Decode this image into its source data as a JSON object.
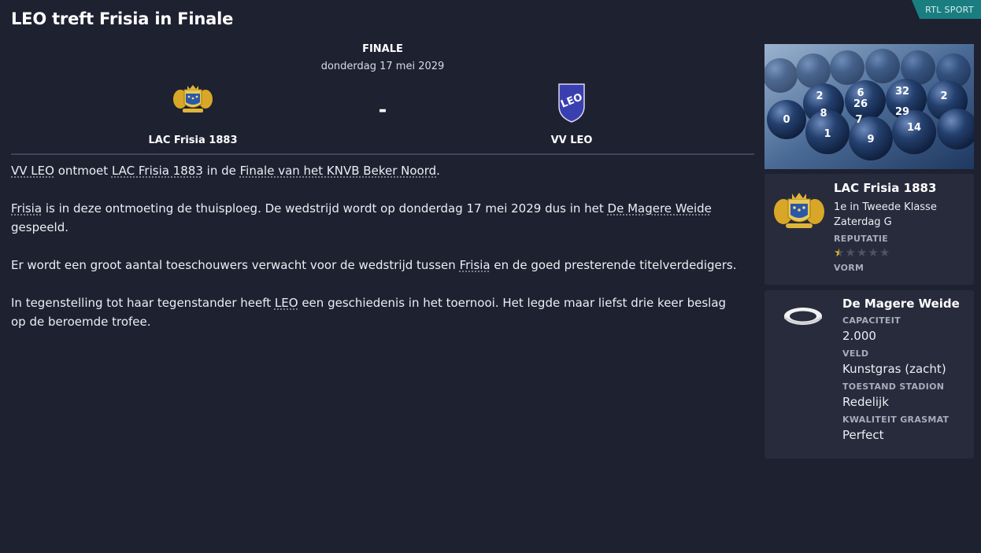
{
  "headline": "LEO treft Frisia in Finale",
  "source": "RTL SPORT",
  "match": {
    "round": "FINALE",
    "date": "donderdag 17 mei 2029",
    "home_team": "LAC Frisia 1883",
    "away_team": "VV LEO",
    "separator": "-",
    "away_crest_text": "LEO"
  },
  "article": {
    "p1": {
      "a": "VV LEO",
      "b": " ontmoet ",
      "c": "LAC Frisia 1883",
      "d": " in de ",
      "e": "Finale van het KNVB Beker Noord",
      "f": "."
    },
    "p2": {
      "a": "Frisia",
      "b": " is in deze ontmoeting de thuisploeg. De wedstrijd wordt op donderdag 17 mei 2029 dus in het ",
      "c": "De Magere Weide",
      "d": " gespeeld."
    },
    "p3": {
      "a": "Er wordt een groot aantal toeschouwers verwacht voor de wedstrijd tussen ",
      "b": "Frisia",
      "c": " en de goed presterende titelverdedigers."
    },
    "p4": {
      "a": "In tegenstelling tot haar tegenstander heeft ",
      "b": "LEO",
      "c": " een geschiedenis in het toernooi. Het legde maar liefst drie keer beslag op de beroemde trofee."
    }
  },
  "photo": {
    "ball_numbers": [
      "2",
      "6",
      "26",
      "32",
      "29",
      "2",
      "7",
      "14",
      "9",
      "1",
      "0",
      "8"
    ]
  },
  "club_card": {
    "name": "LAC Frisia 1883",
    "position": "1e in Tweede Klasse",
    "league": "Zaterdag G",
    "reputation_label": "REPUTATIE",
    "reputation_stars": 0.5,
    "reputation_max": 5,
    "form_label": "VORM"
  },
  "stadium_card": {
    "name": "De Magere Weide",
    "capacity_label": "CAPACITEIT",
    "capacity": "2.000",
    "pitch_label": "VELD",
    "pitch": "Kunstgras (zacht)",
    "condition_label": "TOESTAND STADION",
    "condition": "Redelijk",
    "grass_label": "KWALITEIT GRASMAT",
    "grass": "Perfect"
  },
  "colors": {
    "background": "#1e2130",
    "card": "#272b3b",
    "source_tag": "#1a7e80",
    "star_filled": "#e8b820",
    "star_empty": "#4d5264",
    "leo_blue": "#3a3fb0"
  },
  "icons": {
    "home_crest": "frisia-crest-icon",
    "away_crest": "leo-crest-icon",
    "stadium": "stadium-icon"
  }
}
